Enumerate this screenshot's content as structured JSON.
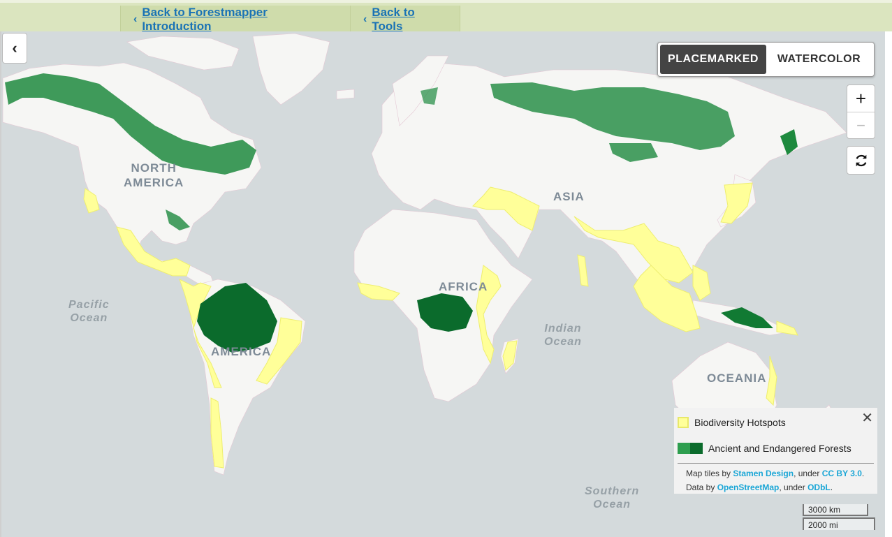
{
  "nav": {
    "back_intro": "Back to Forestmapper Introduction",
    "back_tools": "Back to Tools"
  },
  "basemap_toggle": {
    "active": "PLACEMARKED",
    "inactive": "WATERCOLOR"
  },
  "zoom": {
    "in": "+",
    "out": "−"
  },
  "labels": {
    "north_america": "NORTH AMERICA",
    "north_america_l1": "NORTH",
    "north_america_l2": "AMERICA",
    "south_america": "AMERICA",
    "asia": "ASIA",
    "africa": "AFRICA",
    "oceania": "OCEANIA",
    "pacific_l1": "Pacific",
    "pacific_l2": "Ocean",
    "indian_l1": "Indian",
    "indian_l2": "Ocean",
    "southern_l1": "Southern",
    "southern_l2": "Ocean"
  },
  "legend": {
    "items": [
      {
        "label": "Biodiversity Hotspots",
        "color": "#ffff99"
      },
      {
        "label": "Ancient and Endangered Forests",
        "colors": [
          "#2e9e4f",
          "#0b6b2c"
        ]
      }
    ],
    "close": "✕",
    "attribution": {
      "t1": "Map tiles by ",
      "l1": "Stamen Design",
      "t2": ", under ",
      "l2": "CC BY 3.0",
      "t3": ". Data by ",
      "l3": "OpenStreetMap",
      "t4": ", under ",
      "l4": "ODbL",
      "t5": "."
    }
  },
  "scale": {
    "km": "3000 km",
    "mi": "2000 mi"
  },
  "colors": {
    "water": "#d4dadc",
    "land": "#f6f6f4",
    "hotspot": "#ffff99",
    "forest": "#0b6b2c"
  }
}
